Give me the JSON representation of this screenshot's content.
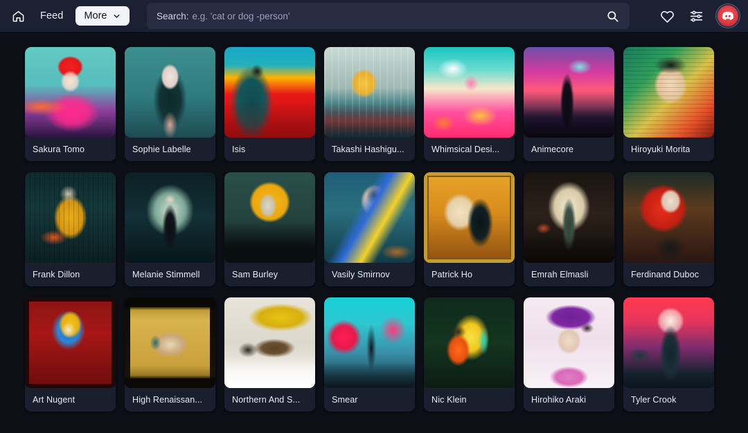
{
  "header": {
    "home_icon": "home-icon",
    "feed_label": "Feed",
    "more_label": "More",
    "more_chevron_icon": "chevron-down-icon",
    "search_label": "Search:",
    "search_placeholder": "e.g. 'cat or dog -person'",
    "search_value": "",
    "search_submit_icon": "search-icon",
    "favorites_icon": "heart-icon",
    "settings_icon": "sliders-icon",
    "avatar_icon": "user-avatar",
    "colors": {
      "bar_bg": "#1b2033",
      "search_bg": "#272c42",
      "more_bg": "#f2f4f9",
      "avatar_red": "#e03a42",
      "page_bg": "#0d0f17",
      "card_bg": "#1a1f2d"
    }
  },
  "grid": {
    "rows": [
      {
        "cards": [
          {
            "label": "Sakura Tomo"
          },
          {
            "label": "Sophie Labelle"
          },
          {
            "label": "Isis"
          },
          {
            "label": "Takashi Hashigu..."
          },
          {
            "label": "Whimsical Desi..."
          },
          {
            "label": "Animecore"
          },
          {
            "label": "Hiroyuki Morita"
          }
        ]
      },
      {
        "cards": [
          {
            "label": "Frank Dillon"
          },
          {
            "label": "Melanie Stimmell"
          },
          {
            "label": "Sam Burley"
          },
          {
            "label": "Vasily Smirnov"
          },
          {
            "label": "Patrick Ho"
          },
          {
            "label": "Emrah Elmasli"
          },
          {
            "label": "Ferdinand Duboc"
          }
        ]
      },
      {
        "cards": [
          {
            "label": "Art Nugent"
          },
          {
            "label": "High Renaissan..."
          },
          {
            "label": "Northern And S..."
          },
          {
            "label": "Smear"
          },
          {
            "label": "Nic Klein"
          },
          {
            "label": "Hirohiko Araki"
          },
          {
            "label": "Tyler Crook"
          }
        ]
      }
    ]
  }
}
